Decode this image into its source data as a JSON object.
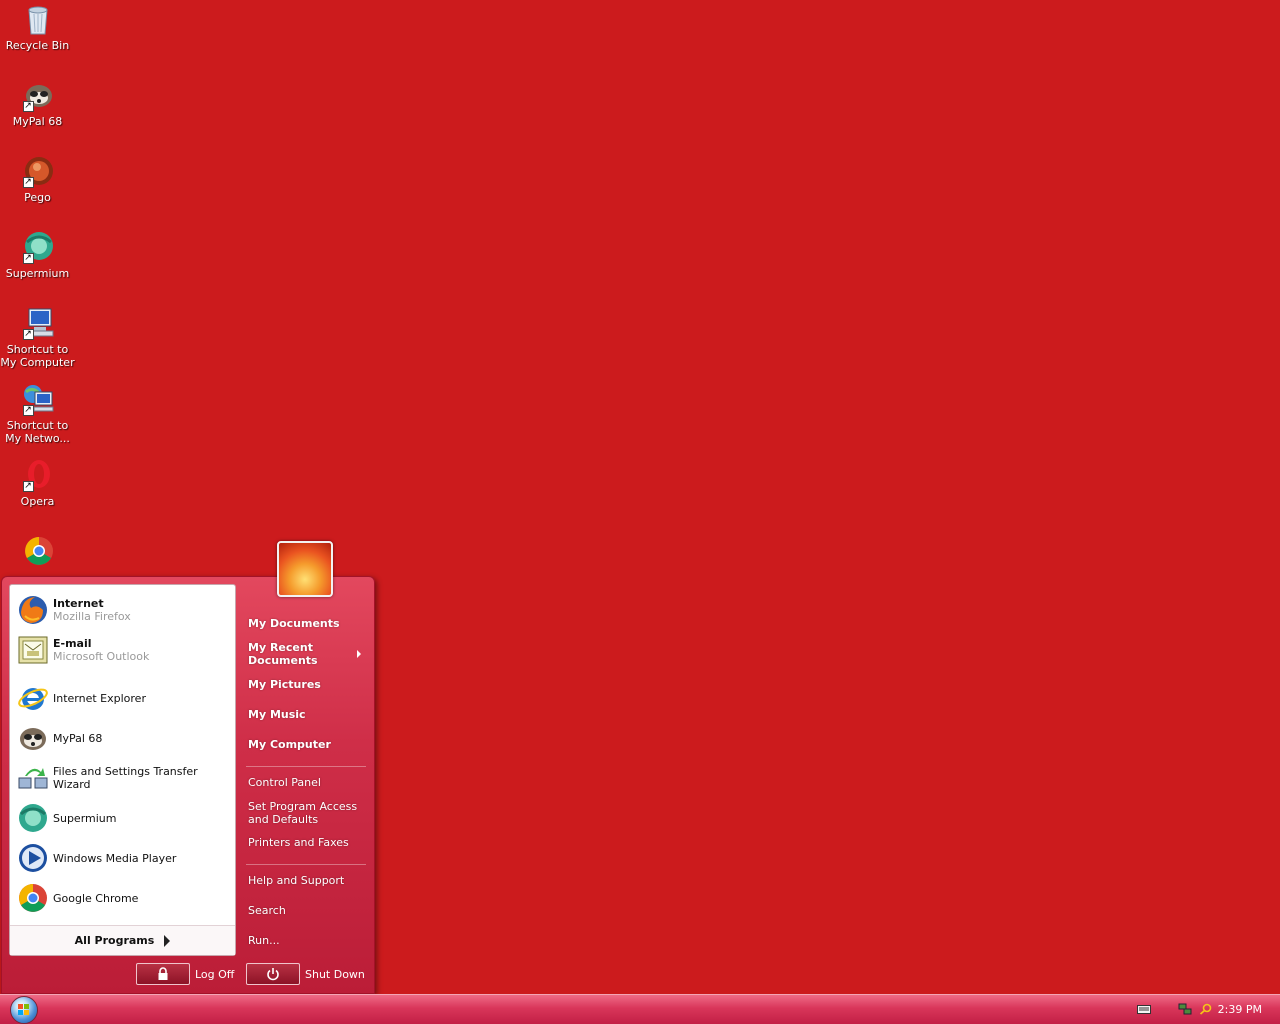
{
  "desktop": {
    "background_color": "#cc1b1d",
    "icons": [
      {
        "label": "Recycle Bin",
        "icon": "recycle-bin-icon"
      },
      {
        "label": "MyPal 68",
        "icon": "mypal-icon"
      },
      {
        "label": "Pego",
        "icon": "pego-icon"
      },
      {
        "label": "Supermium",
        "icon": "supermium-icon"
      },
      {
        "label_line1": "Shortcut to",
        "label_line2": "My Computer",
        "icon": "my-computer-icon"
      },
      {
        "label_line1": "Shortcut to",
        "label_line2": "My Netwo...",
        "icon": "my-network-icon"
      },
      {
        "label": "Opera",
        "icon": "opera-icon"
      },
      {
        "label": "",
        "icon": "google-chrome-icon"
      }
    ]
  },
  "start_menu": {
    "pinned": [
      {
        "name": "Internet",
        "sub": "Mozilla Firefox",
        "icon": "firefox-icon"
      },
      {
        "name": "E-mail",
        "sub": "Microsoft Outlook",
        "icon": "outlook-icon"
      }
    ],
    "recent": [
      {
        "name": "Internet Explorer",
        "icon": "internet-explorer-icon"
      },
      {
        "name": "MyPal 68",
        "icon": "mypal-icon"
      },
      {
        "name": "Files and Settings Transfer Wizard",
        "icon": "transfer-wizard-icon"
      },
      {
        "name": "Supermium",
        "icon": "supermium-icon"
      },
      {
        "name": "Windows Media Player",
        "icon": "windows-media-player-icon"
      },
      {
        "name": "Google Chrome",
        "icon": "google-chrome-icon"
      }
    ],
    "all_programs_label": "All Programs",
    "places": {
      "my_documents": "My Documents",
      "my_recent_line1": "My Recent",
      "my_recent_line2": "Documents",
      "my_pictures": "My Pictures",
      "my_music": "My Music",
      "my_computer": "My Computer",
      "control_panel": "Control Panel",
      "set_program_line1": "Set Program Access",
      "set_program_line2": "and Defaults",
      "printers": "Printers and Faxes",
      "help": "Help and Support",
      "search": "Search",
      "run": "Run..."
    },
    "log_off_label": "Log Off",
    "shut_down_label": "Shut Down"
  },
  "taskbar": {
    "clock": "2:39 PM"
  }
}
